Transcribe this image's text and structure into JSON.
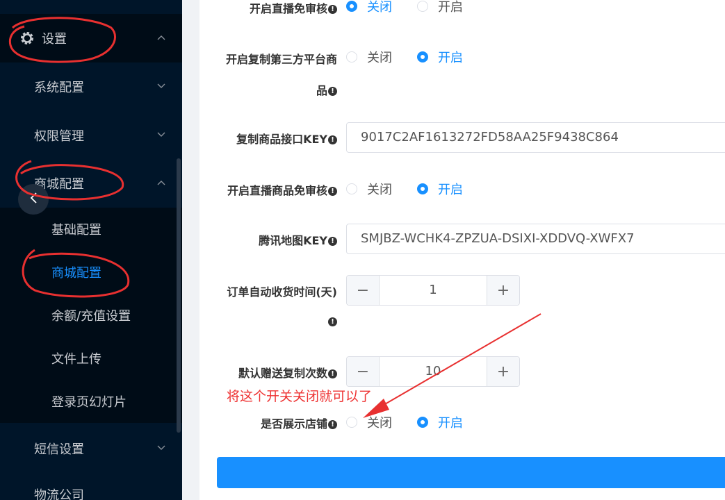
{
  "sidebar": {
    "settings_label": "设置",
    "system_config": "系统配置",
    "permission": "权限管理",
    "mall_config_group": "商城配置",
    "sub_basic": "基础配置",
    "sub_mall": "商城配置",
    "sub_balance": "余额/充值设置",
    "sub_upload": "文件上传",
    "sub_login_slides": "登录页幻灯片",
    "sms": "短信设置",
    "logistics": "物流公司"
  },
  "form": {
    "live_free_review": {
      "label": "开启直播免审核",
      "off": "关闭",
      "on": "开启",
      "selected": "off"
    },
    "copy_third_party": {
      "label_line1": "开启复制第三方平台商",
      "label_line2": "品",
      "off": "关闭",
      "on": "开启",
      "selected": "on"
    },
    "copy_api_key": {
      "label": "复制商品接口KEY",
      "value": "9017C2AF1613272FD58AA25F9438C864"
    },
    "live_product_free_review": {
      "label": "开启直播商品免审核",
      "off": "关闭",
      "on": "开启",
      "selected": "on"
    },
    "tencent_map_key": {
      "label": "腾讯地图KEY",
      "value": "SMJBZ-WCHK4-ZPZUA-DSIXI-XDDVQ-XWFX7"
    },
    "auto_receive_days": {
      "label": "订单自动收货时间(天)",
      "value": "1"
    },
    "default_copy_count": {
      "label": "默认赠送复制次数",
      "value": "10"
    },
    "show_store": {
      "label": "是否展示店铺",
      "off": "关闭",
      "on": "开启",
      "selected": "on"
    }
  },
  "annotation": {
    "text": "将这个开关关闭就可以了",
    "color": "#e83030"
  },
  "colors": {
    "accent": "#1890ff",
    "sidebar_bg": "#001529",
    "annotation_red": "#e83030"
  },
  "icons": {
    "info": "!",
    "minus": "−",
    "plus": "+"
  }
}
